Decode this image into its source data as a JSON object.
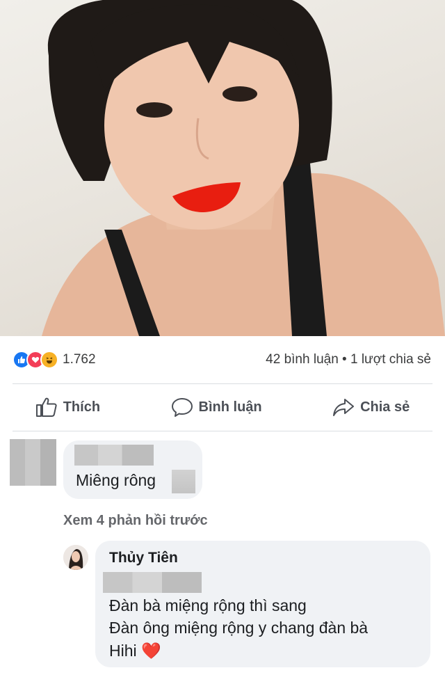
{
  "post": {
    "reactions": {
      "icons": [
        "like-icon",
        "love-icon",
        "haha-icon"
      ],
      "colors": {
        "like": "#1877f2",
        "love": "#f33e58",
        "haha": "#f7b125"
      },
      "count": "1.762"
    },
    "comments_count": "42 bình luận",
    "separator": "•",
    "shares_count": "1 lượt chia sẻ"
  },
  "actions": {
    "like": "Thích",
    "comment": "Bình luận",
    "share": "Chia sẻ"
  },
  "comment1": {
    "text": "Miêng rông"
  },
  "view_previous_replies": "Xem 4 phản hồi trước",
  "reply": {
    "author": "Thủy Tiên",
    "lines": [
      "Đàn bà miệng rộng thì sang",
      "Đàn ông miệng rộng y chang đàn bà",
      "Hihi"
    ],
    "emoji": "❤️"
  }
}
